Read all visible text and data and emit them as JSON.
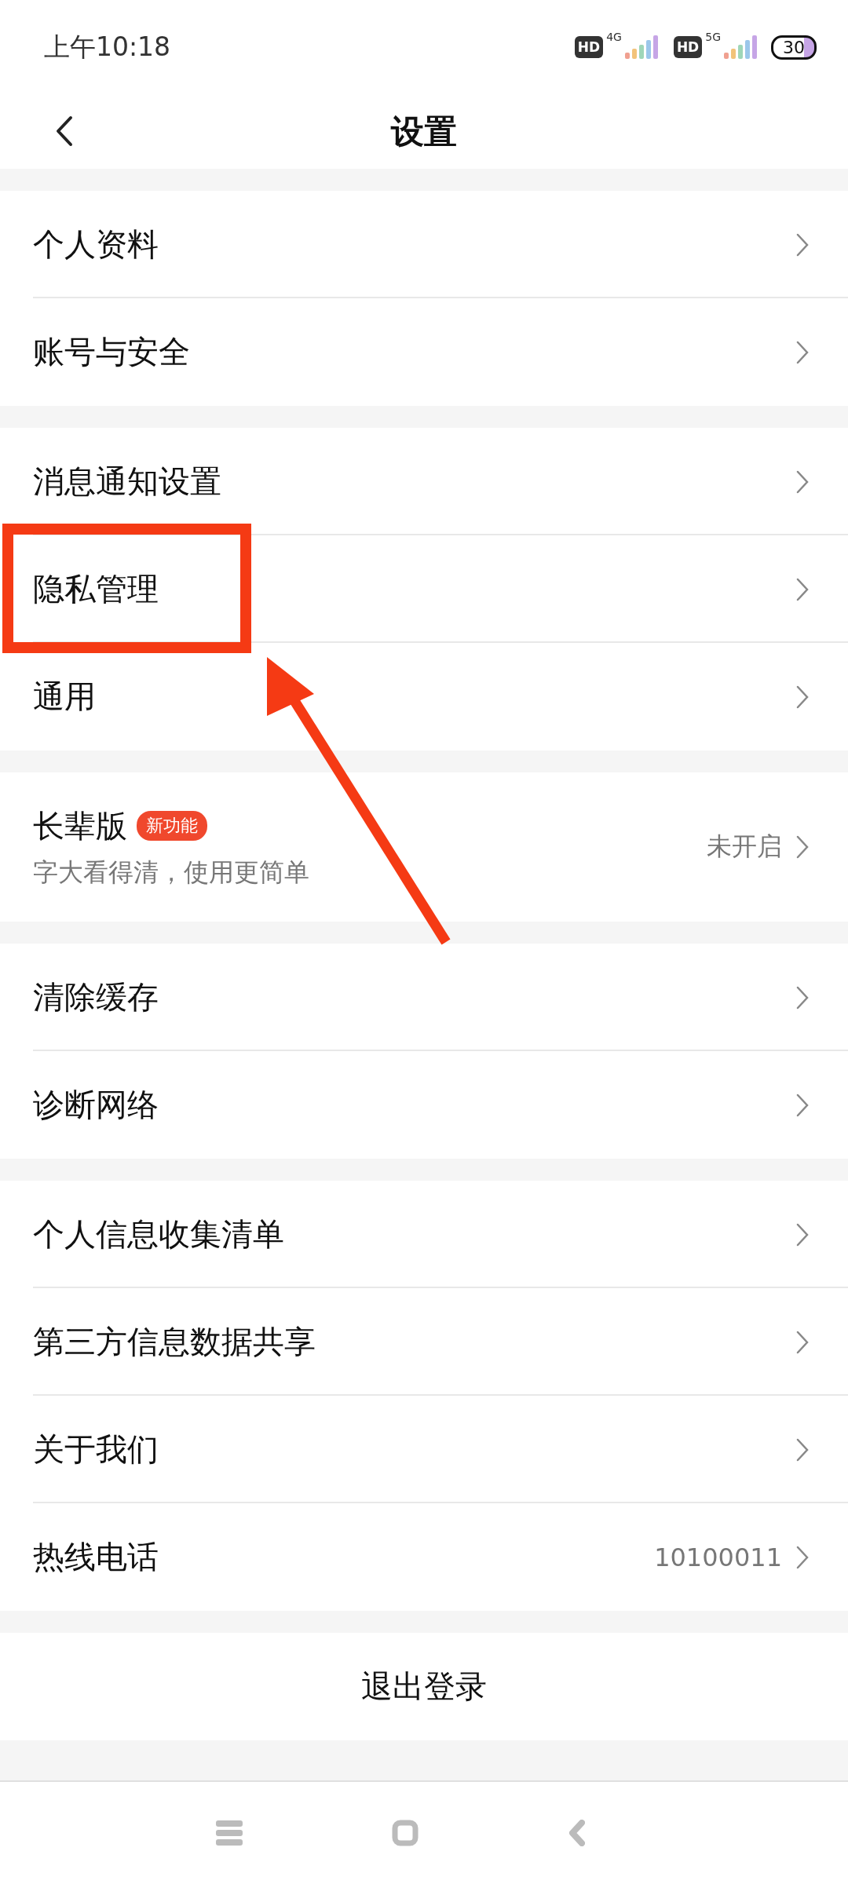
{
  "status_bar": {
    "time": "上午10:18",
    "sim1": {
      "hd": "HD",
      "network": "4G"
    },
    "sim2": {
      "hd": "HD",
      "network": "5G"
    },
    "battery": "30"
  },
  "header": {
    "title": "设置"
  },
  "groups": [
    {
      "items": [
        {
          "label": "个人资料",
          "highlighted": false
        },
        {
          "label": "账号与安全",
          "highlighted": false
        }
      ]
    },
    {
      "items": [
        {
          "label": "消息通知设置",
          "highlighted": false
        },
        {
          "label": "隐私管理",
          "highlighted": true
        },
        {
          "label": "通用",
          "highlighted": false
        }
      ]
    },
    {
      "items": [
        {
          "label": "长辈版",
          "badge": "新功能",
          "subtitle": "字大看得清，使用更简单",
          "value": "未开启",
          "highlighted": false
        }
      ]
    },
    {
      "items": [
        {
          "label": "清除缓存",
          "highlighted": false
        },
        {
          "label": "诊断网络",
          "highlighted": false
        }
      ]
    },
    {
      "items": [
        {
          "label": "个人信息收集清单",
          "highlighted": false
        },
        {
          "label": "第三方信息数据共享",
          "highlighted": false
        },
        {
          "label": "关于我们",
          "highlighted": false
        },
        {
          "label": "热线电话",
          "value": "10100011",
          "highlighted": false
        }
      ]
    }
  ],
  "logout": "退出登录"
}
